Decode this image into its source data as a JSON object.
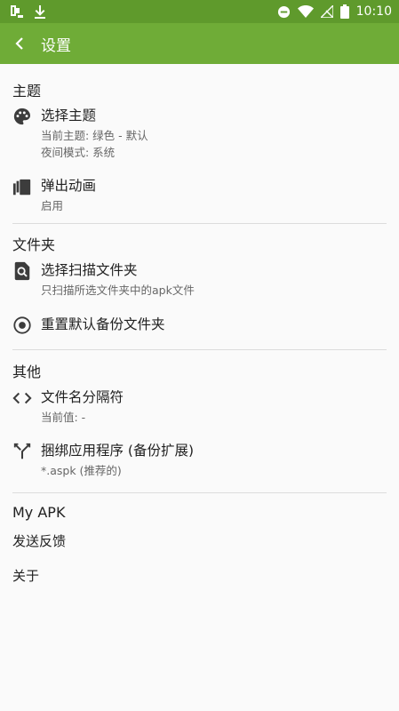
{
  "status_bar": {
    "time": "10:10"
  },
  "toolbar": {
    "title": "设置"
  },
  "sections": {
    "theme": {
      "header": "主题",
      "choose_theme": {
        "title": "选择主题",
        "line1": "当前主题: 绿色 - 默认",
        "line2": "夜间模式: 系统"
      },
      "popup_animation": {
        "title": "弹出动画",
        "value": "启用"
      }
    },
    "folder": {
      "header": "文件夹",
      "scan_folder": {
        "title": "选择扫描文件夹",
        "subtitle": "只扫描所选文件夹中的apk文件"
      },
      "reset_backup": {
        "title": "重置默认备份文件夹"
      }
    },
    "other": {
      "header": "其他",
      "separator": {
        "title": "文件名分隔符",
        "subtitle": "当前值: -"
      },
      "bundle": {
        "title": "捆绑应用程序 (备份扩展)",
        "subtitle": "*.aspk (推荐的)"
      }
    },
    "myapk": {
      "header": "My APK",
      "feedback": "发送反馈",
      "about": "关于"
    }
  },
  "colors": {
    "toolbar": "#6fac37",
    "statusbar": "#5f9a2c",
    "background": "#fafafa"
  }
}
